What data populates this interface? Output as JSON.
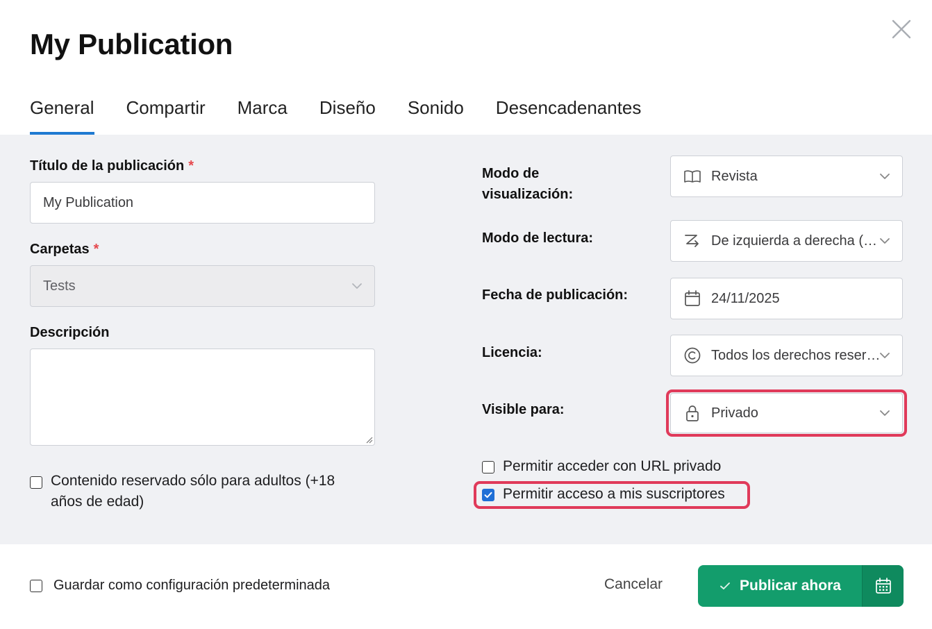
{
  "dialog": {
    "title": "My Publication"
  },
  "tabs": [
    {
      "label": "General"
    },
    {
      "label": "Compartir"
    },
    {
      "label": "Marca"
    },
    {
      "label": "Diseño"
    },
    {
      "label": "Sonido"
    },
    {
      "label": "Desencadenantes"
    }
  ],
  "left": {
    "title_label": "Título de la publicación",
    "title_value": "My Publication",
    "folders_label": "Carpetas",
    "folders_value": "Tests",
    "description_label": "Descripción",
    "description_value": "",
    "adult_label_line1": "Contenido reservado sólo para adultos (+18",
    "adult_label_line2": "años de edad)",
    "required_mark": "*"
  },
  "right": {
    "view_mode_label_line1": "Modo de",
    "view_mode_label_line2": "visualización:",
    "view_mode_value": "Revista",
    "reading_mode_label": "Modo de lectura:",
    "reading_mode_value": "De izquierda a derecha (occidental)",
    "publish_date_label": "Fecha de publicación:",
    "publish_date_value": "24/11/2025",
    "license_label": "Licencia:",
    "license_value": "Todos los derechos reservados",
    "visible_label": "Visible para:",
    "visible_value": "Privado",
    "private_url_label": "Permitir acceder con URL privado",
    "subscribers_label": "Permitir acceso a mis suscriptores"
  },
  "footer": {
    "save_default_label": "Guardar como configuración predeterminada",
    "cancel_label": "Cancelar",
    "publish_label": "Publicar ahora"
  },
  "state": {
    "adult_checked": false,
    "private_url_checked": false,
    "subscribers_checked": true,
    "save_default_checked": false
  },
  "colors": {
    "accent_tab": "#1f7ad1",
    "highlight": "#e03a5a",
    "publish_button": "#139d6c",
    "checkbox_checked": "#1f6fd6",
    "required": "#e5484d"
  },
  "icons": {
    "close": "close-icon",
    "view_mode": "book-open-icon",
    "reading_mode": "reading-direction-icon",
    "date": "calendar-icon",
    "license": "copyright-icon",
    "visibility": "lock-icon",
    "publish": "check-icon",
    "schedule": "calendar-schedule-icon"
  }
}
